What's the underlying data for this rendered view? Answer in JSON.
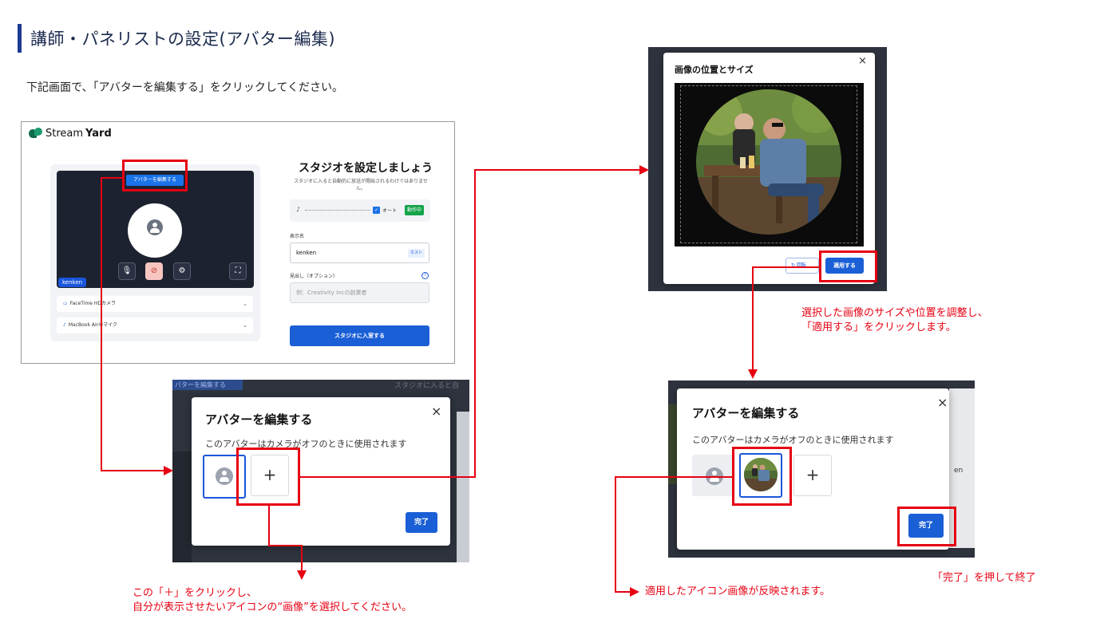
{
  "header": {
    "title": "講師・パネリストの設定(アバター編集)",
    "intro": "下記画面で、「アバターを編集する」をクリックしてください。"
  },
  "setup_screen": {
    "logo_prefix": "Stream",
    "logo_suffix": "Yard",
    "edit_avatar_button": "アバターを編集する",
    "name_tag": "kenken",
    "camera_device": "FaceTime HDカメラ",
    "mic_device": "MacBook Airのマイク",
    "title": "スタジオを設定しましょう",
    "subtitle": "スタジオに入ると自動的に放送が開始されるわけではありません。",
    "auto_label": "オート",
    "active_badge": "動作中",
    "display_name_label": "表示名",
    "display_name_value": "kenken",
    "host_badge": "ホスト",
    "headline_label": "見出し（オプション）",
    "headline_placeholder": "例：Creativity Incの創業者",
    "enter_button": "スタジオに入室する"
  },
  "avatar_modal": {
    "bg_button_text": "バターを編集する",
    "bg_text": "スタジオに入ると自",
    "title": "アバターを編集する",
    "description": "このアバターはカメラがオフのときに使用されます",
    "plus": "+",
    "done_button": "完了",
    "close": "×"
  },
  "crop_modal": {
    "title": "画像の位置とサイズ",
    "close": "×",
    "rotate_button": "回転",
    "apply_button": "適用する"
  },
  "avatar_modal_applied": {
    "title": "アバターを編集する",
    "description": "このアバターはカメラがオフのときに使用されます",
    "plus": "+",
    "done_button": "完了",
    "close": "×",
    "bg_text": "en"
  },
  "notes": {
    "plus_note_line1": "この「＋」をクリックし、",
    "plus_note_line2": "自分が表示させたいアイコンの“画像”を選択してください。",
    "apply_note_line1": "選択した画像のサイズや位置を調整し、",
    "apply_note_line2": "「適用する」をクリックします。",
    "reflect_note": "適用したアイコン画像が反映されます。",
    "done_note": "「完了」を押して終了"
  },
  "colors": {
    "accent_blue": "#1a5fd6",
    "highlight_red": "#e60012",
    "title_navy": "#1b2a4e"
  }
}
